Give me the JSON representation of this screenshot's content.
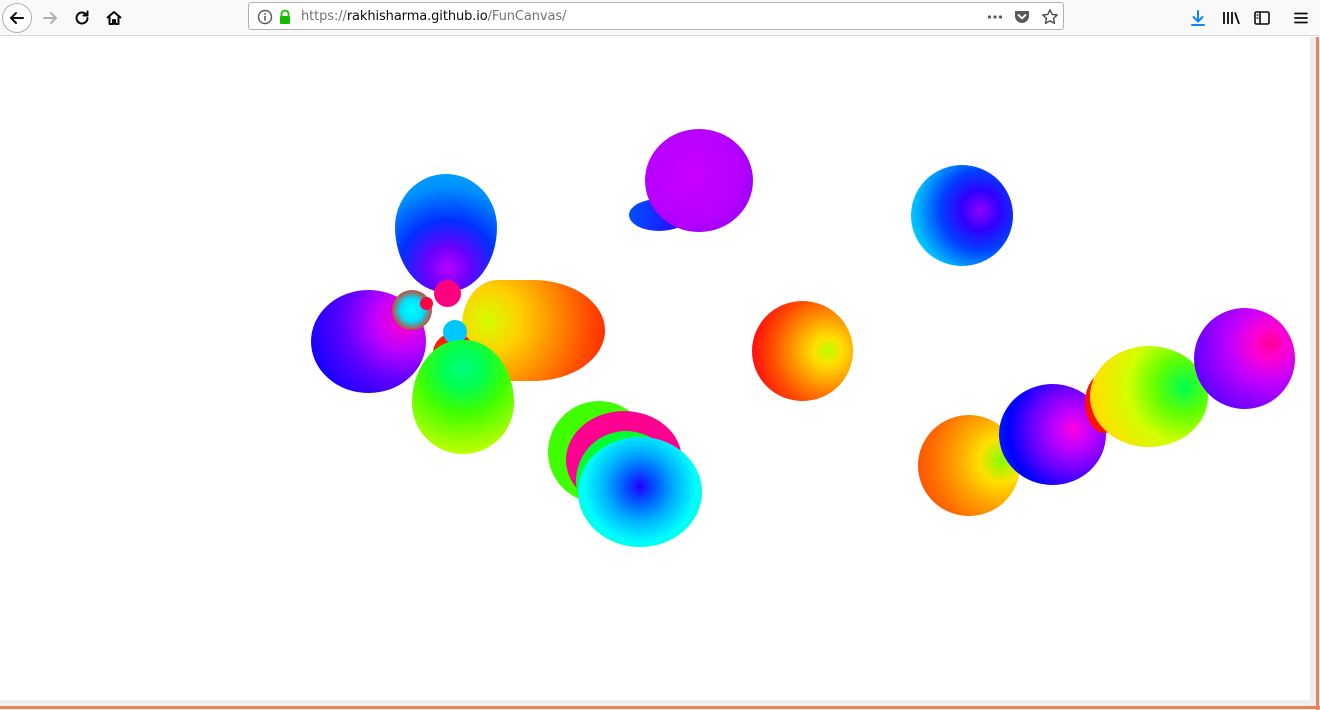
{
  "browser": {
    "url_prefix": "https://",
    "url_host": "rakhisharma.github.io",
    "url_path": "/FunCanvas/",
    "icons": {
      "back": "back-arrow-icon",
      "forward": "forward-arrow-icon",
      "reload": "reload-icon",
      "home": "home-icon",
      "info": "info-icon",
      "lock": "lock-icon",
      "page_actions": "more-dots-icon",
      "pocket": "pocket-icon",
      "bookmark": "star-icon",
      "download": "download-icon",
      "library": "library-icon",
      "sidebar": "sidebar-icon",
      "menu": "hamburger-menu-icon"
    },
    "colors": {
      "lock": "#12bc00",
      "download": "#0a84ff",
      "scroll_accent": "#e8845c"
    }
  }
}
